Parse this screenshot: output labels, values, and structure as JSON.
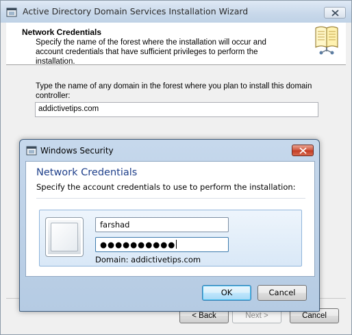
{
  "wizard": {
    "title": "Active Directory Domain Services Installation Wizard",
    "header_title": "Network Credentials",
    "header_description": "Specify the name of the forest where the installation will occur and account credentials that have sufficient privileges to perform the installation.",
    "prompt": "Type the name of any domain in the forest where you plan to install this domain controller:",
    "domain_value": "addictivetips.com",
    "back_label": "< Back",
    "next_label": "Next >",
    "cancel_label": "Cancel",
    "icons": [
      "window-icon",
      "close-icon",
      "book-icon"
    ]
  },
  "security_dialog": {
    "title": "Windows Security",
    "heading": "Network Credentials",
    "description": "Specify the account credentials to use to perform the installation:",
    "username_value": "farshad",
    "password_mask": "●●●●●●●●●●",
    "domain_line": "Domain: addictivetips.com",
    "ok_label": "OK",
    "cancel_label": "Cancel",
    "icons": [
      "window-icon",
      "close-icon",
      "user-tile-icon"
    ]
  },
  "colors": {
    "heading_blue": "#1e3f8a",
    "close_red": "#c23a22",
    "tile_border": "#8fb4db"
  }
}
